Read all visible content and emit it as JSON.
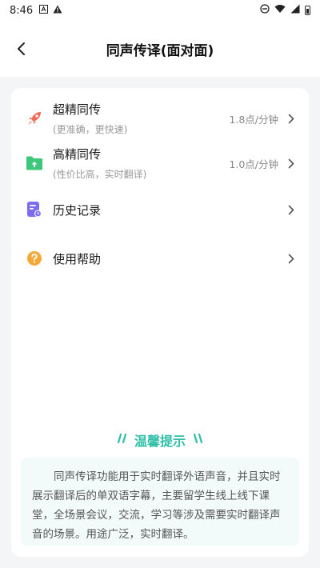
{
  "status_bar": {
    "time": "8:46"
  },
  "header": {
    "title": "同声传译(面对面)"
  },
  "menu": {
    "items": [
      {
        "label": "超精同传",
        "subtitle": "(更准确，更快速)",
        "price": "1.8点/分钟",
        "icon": "rocket-icon",
        "color": "#ef6a5b"
      },
      {
        "label": "高精同传",
        "subtitle": "(性价比高，实时翻译)",
        "price": "1.0点/分钟",
        "icon": "folder-upload-icon",
        "color": "#3cc77a"
      },
      {
        "label": "历史记录",
        "icon": "history-icon",
        "color": "#7b6cf0"
      },
      {
        "label": "使用帮助",
        "icon": "help-icon",
        "color": "#f4a83a"
      }
    ]
  },
  "tips": {
    "title": "温馨提示",
    "text": "同声传译功能用于实时翻译外语声音，并且实时展示翻译后的单双语字幕，主要留学生线上线下课堂，全场景会议，交流，学习等涉及需要实时翻译声音的场景。用途广泛，实时翻译。"
  },
  "colors": {
    "accent": "#2fbfa8",
    "background": "#f4f5f7"
  }
}
